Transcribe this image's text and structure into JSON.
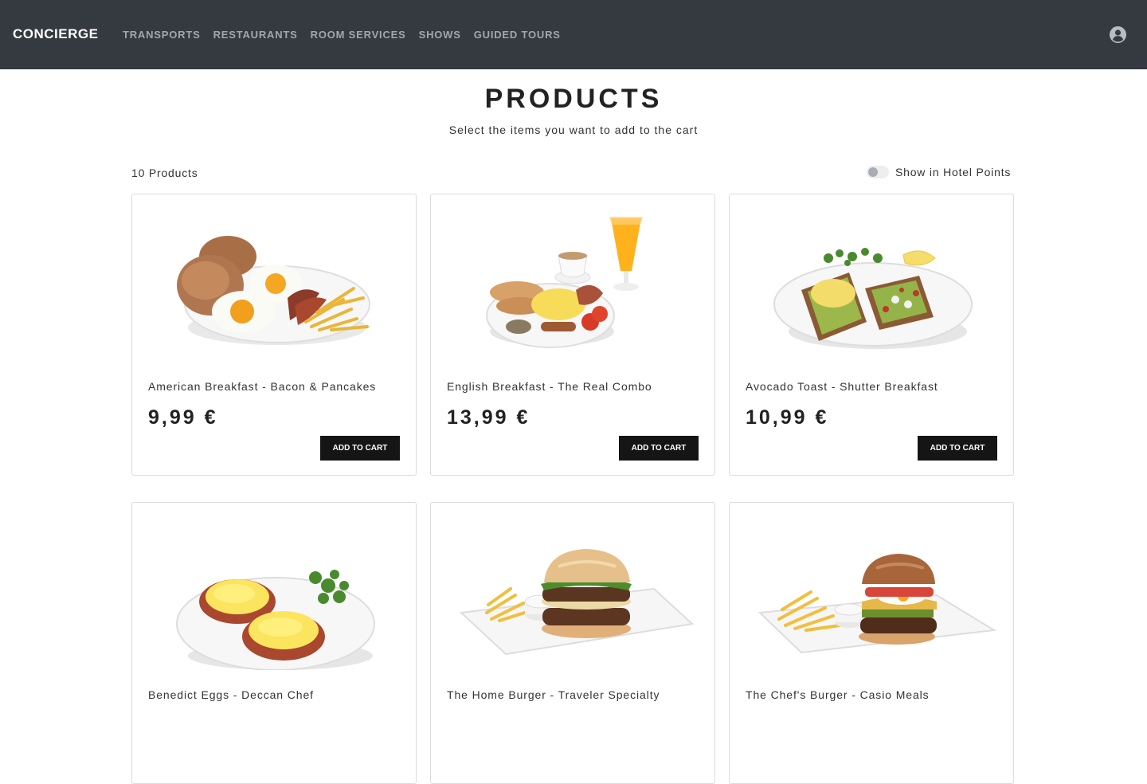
{
  "header": {
    "brand": "CONCIERGE",
    "nav": [
      "TRANSPORTS",
      "RESTAURANTS",
      "ROOM SERVICES",
      "SHOWS",
      "GUIDED TOURS"
    ]
  },
  "page": {
    "title": "PRODUCTS",
    "subtitle": "Select the items you want to add to the cart",
    "count": "10 Products",
    "toggle_label": "Show in Hotel Points",
    "toggle_on": false
  },
  "products": [
    {
      "name": "American Breakfast - Bacon & Pancakes",
      "price": "9,99 €",
      "button": "ADD TO CART"
    },
    {
      "name": "English Breakfast - The Real Combo",
      "price": "13,99 €",
      "button": "ADD TO CART"
    },
    {
      "name": "Avocado Toast - Shutter Breakfast",
      "price": "10,99 €",
      "button": "ADD TO CART"
    },
    {
      "name": "Benedict Eggs - Deccan Chef",
      "price": "",
      "button": ""
    },
    {
      "name": "The Home Burger - Traveler Specialty",
      "price": "",
      "button": ""
    },
    {
      "name": "The Chef's Burger - Casio Meals",
      "price": "",
      "button": ""
    }
  ],
  "colors": {
    "navbar": "#343a40",
    "button": "#151515",
    "card_border": "#dcdcdc"
  }
}
